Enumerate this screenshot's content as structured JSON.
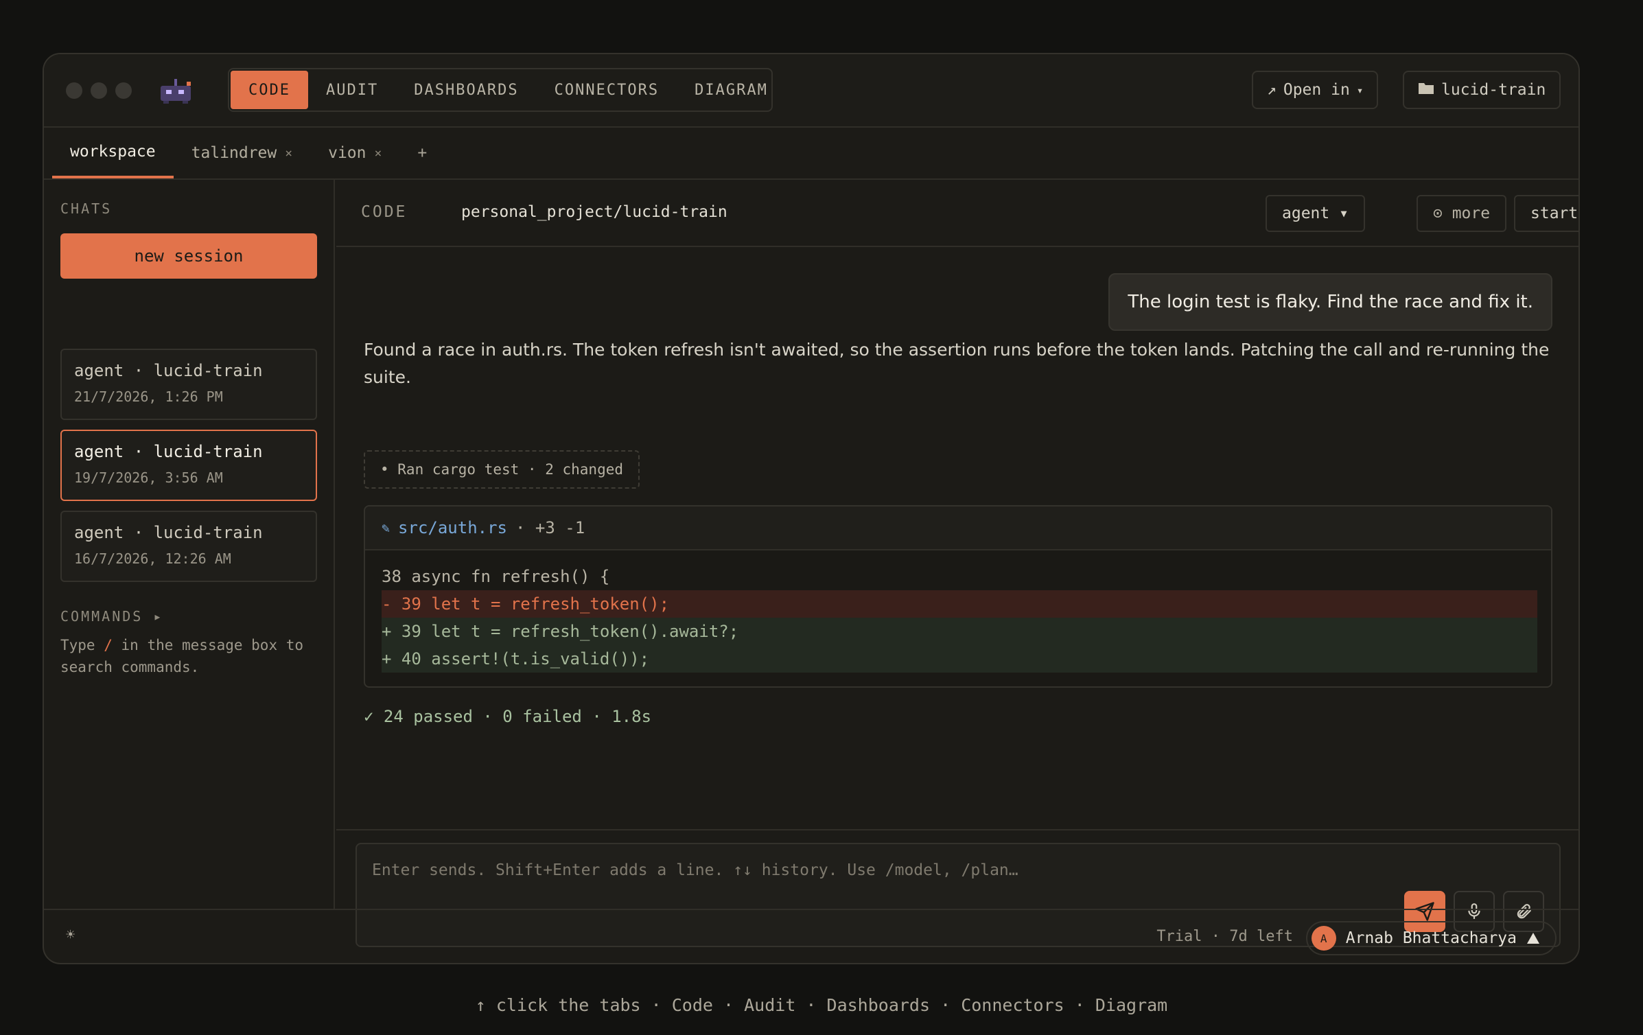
{
  "nav": {
    "tabs": [
      {
        "label": "CODE",
        "active": true
      },
      {
        "label": "AUDIT"
      },
      {
        "label": "DASHBOARDS"
      },
      {
        "label": "CONNECTORS"
      },
      {
        "label": "DIAGRAM"
      }
    ],
    "open_in_label": "Open in",
    "project_label": "lucid-train"
  },
  "workspace_tabs": [
    {
      "label": "workspace",
      "active": true
    },
    {
      "label": "talindrew",
      "close": "×"
    },
    {
      "label": "vion",
      "close": "×"
    }
  ],
  "add_tab": "+",
  "sidebar": {
    "chats_heading": "CHATS",
    "new_session": "new session",
    "chats": [
      {
        "title": "agent · lucid-train",
        "date": "21/7/2026, 1:26 PM"
      },
      {
        "title": "agent · lucid-train",
        "date": "19/7/2026, 3:56 AM",
        "active": true
      },
      {
        "title": "agent · lucid-train",
        "date": "16/7/2026, 12:26 AM"
      }
    ],
    "commands_heading": "COMMANDS ▸",
    "commands_help_pre": "Type ",
    "commands_help_slash": "/",
    "commands_help_post": " in the message box to search commands."
  },
  "main": {
    "section_label": "CODE",
    "path": "personal_project/lucid-train",
    "mode_label": "agent ▾",
    "more_label": "⊙ more",
    "start_label": "start",
    "user_message": "The login test is flaky. Find the race and fix it.",
    "agent_reply": "Found a race in auth.rs. The token refresh isn't awaited, so the assertion runs before the token lands. Patching the call and re-running the suite.",
    "ran_summary": "• Ran cargo test · 2 changed",
    "diff": {
      "file": "src/auth.rs",
      "stats": "· +3 -1",
      "lines": [
        {
          "kind": "ctx",
          "text": "38 async fn refresh() {"
        },
        {
          "kind": "del",
          "text": "- 39 let t = refresh_token();"
        },
        {
          "kind": "add",
          "text": "+ 39 let t = refresh_token().await?;"
        },
        {
          "kind": "add",
          "text": "+ 40 assert!(t.is_valid());"
        }
      ]
    },
    "result": "✓ 24 passed · 0 failed · 1.8s",
    "composer_placeholder": "Enter sends. Shift+Enter adds a line. ↑↓ history. Use /model, /plan…"
  },
  "footer": {
    "theme_icon": "☀",
    "trial": "Trial · 7d left",
    "avatar_initial": "A",
    "user_name": "Arnab Bhattacharya"
  },
  "hint": "↑ click the tabs · Code · Audit · Dashboards · Connectors · Diagram",
  "colors": {
    "accent": "#e2734b",
    "background": "#121210",
    "window": "#1c1b17"
  }
}
